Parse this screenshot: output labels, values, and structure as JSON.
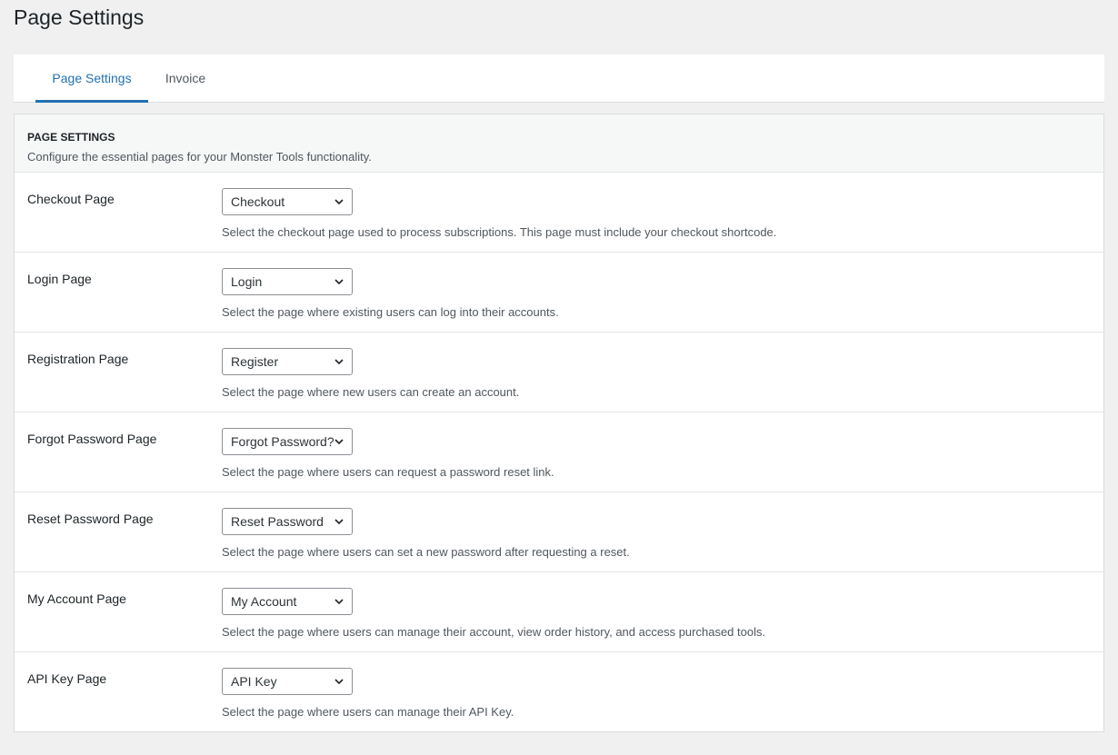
{
  "page": {
    "title": "Page Settings"
  },
  "tabs": [
    {
      "label": "Page Settings",
      "active": true
    },
    {
      "label": "Invoice",
      "active": false
    }
  ],
  "section": {
    "title": "PAGE SETTINGS",
    "description": "Configure the essential pages for your Monster Tools functionality."
  },
  "rows": [
    {
      "label": "Checkout Page",
      "value": "Checkout",
      "description": "Select the checkout page used to process subscriptions. This page must include your checkout shortcode."
    },
    {
      "label": "Login Page",
      "value": "Login",
      "description": "Select the page where existing users can log into their accounts."
    },
    {
      "label": "Registration Page",
      "value": "Register",
      "description": "Select the page where new users can create an account."
    },
    {
      "label": "Forgot Password Page",
      "value": "Forgot Password?",
      "description": "Select the page where users can request a password reset link."
    },
    {
      "label": "Reset Password Page",
      "value": "Reset Password",
      "description": "Select the page where users can set a new password after requesting a reset."
    },
    {
      "label": "My Account Page",
      "value": "My Account",
      "description": "Select the page where users can manage their account, view order history, and access purchased tools."
    },
    {
      "label": "API Key Page",
      "value": "API Key",
      "description": "Select the page where users can manage their API Key."
    }
  ],
  "colors": {
    "accent": "#2271b1",
    "background": "#f0f0f1",
    "text": "#1d2327",
    "muted_text": "#50575e"
  },
  "icons": {
    "select_caret": "chevron-down-icon"
  }
}
